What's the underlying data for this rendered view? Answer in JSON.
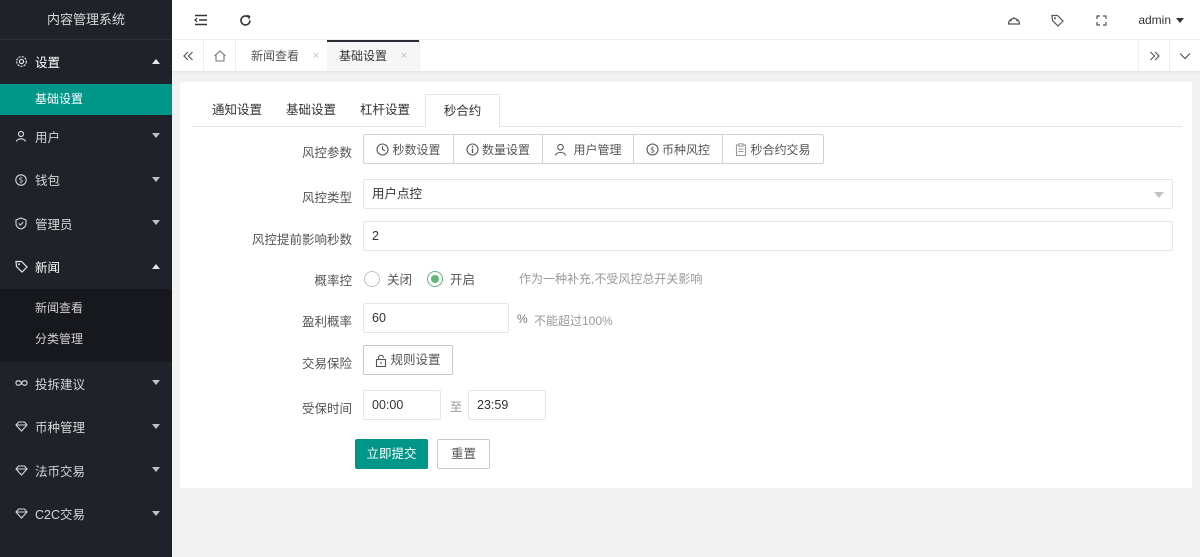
{
  "app": {
    "title": "内容管理系统"
  },
  "sidebar": {
    "items": [
      {
        "label": "设置",
        "icon": "gear-icon",
        "expanded": true,
        "children": [
          {
            "label": "基础设置",
            "active": true
          }
        ]
      },
      {
        "label": "用户",
        "icon": "user-icon",
        "expanded": false
      },
      {
        "label": "钱包",
        "icon": "dollar-icon",
        "expanded": false
      },
      {
        "label": "管理员",
        "icon": "shield-icon",
        "expanded": false
      },
      {
        "label": "新闻",
        "icon": "tag-icon",
        "expanded": true,
        "children": [
          {
            "label": "新闻查看"
          },
          {
            "label": "分类管理"
          }
        ]
      },
      {
        "label": "投拆建议",
        "icon": "infinity-icon",
        "expanded": false
      },
      {
        "label": "币种管理",
        "icon": "diamond-icon",
        "expanded": false
      },
      {
        "label": "法币交易",
        "icon": "diamond-icon",
        "expanded": false
      },
      {
        "label": "C2C交易",
        "icon": "diamond-icon",
        "expanded": false
      }
    ]
  },
  "header": {
    "user": "admin"
  },
  "page_tabs": [
    {
      "label": "新闻查看",
      "close": "×"
    },
    {
      "label": "基础设置",
      "close": "×",
      "active": true
    }
  ],
  "form_tabs": [
    {
      "label": "通知设置"
    },
    {
      "label": "基础设置"
    },
    {
      "label": "杠杆设置"
    },
    {
      "label": "秒合约",
      "active": true
    }
  ],
  "form": {
    "risk_params": {
      "label": "风控参数",
      "buttons": [
        {
          "label": "秒数设置",
          "icon": "clock-icon"
        },
        {
          "label": "数量设置",
          "icon": "info-icon"
        },
        {
          "label": "用户管理",
          "icon": "user-icon"
        },
        {
          "label": "币种风控",
          "icon": "dollar-icon"
        },
        {
          "label": "秒合约交易",
          "icon": "clipboard-icon"
        }
      ]
    },
    "risk_type": {
      "label": "风控类型",
      "value": "用户点控"
    },
    "advance_seconds": {
      "label": "风控提前影响秒数",
      "value": "2"
    },
    "probability": {
      "label": "概率控",
      "options": [
        {
          "label": "关闭",
          "checked": false
        },
        {
          "label": "开启",
          "checked": true
        }
      ],
      "hint": "作为一种补充,不受风控总开关影响"
    },
    "profit_rate": {
      "label": "盈利概率",
      "value": "60",
      "unit": "%",
      "hint": "不能超过100%"
    },
    "insurance": {
      "label": "交易保险",
      "button": "规则设置"
    },
    "insured_time": {
      "label": "受保时间",
      "start": "00:00",
      "separator": "至",
      "end": "23:59"
    },
    "submit": "立即提交",
    "reset": "重置"
  },
  "colors": {
    "sidebar_bg": "#20222a",
    "accent": "#009688",
    "radio_checked": "#5FB878"
  }
}
